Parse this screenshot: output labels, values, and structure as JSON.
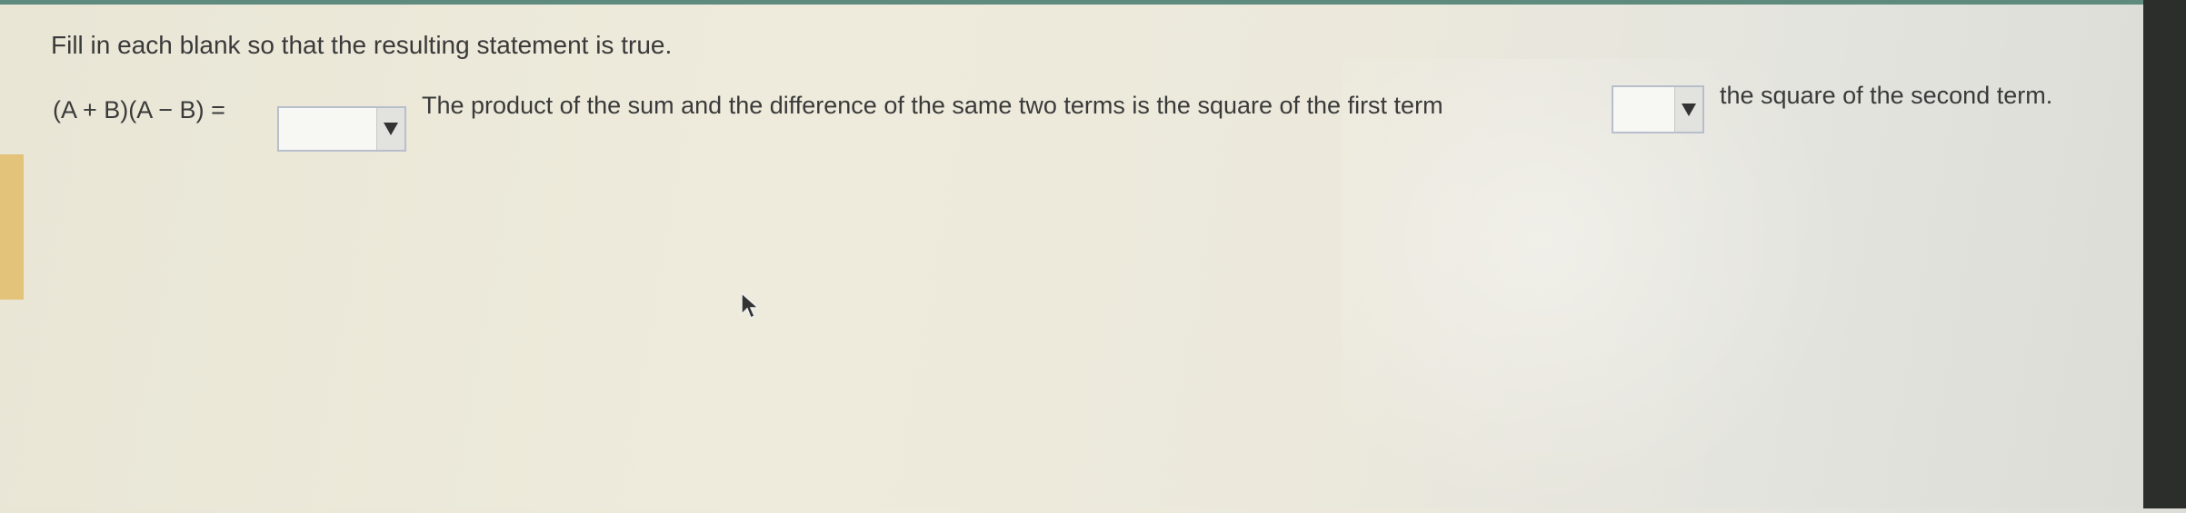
{
  "question": {
    "instructions": "Fill in each blank so that the resulting statement is true.",
    "expression": "(A + B)(A − B) =",
    "statement_part1": "The product of the sum and the difference of the same two terms is the square of the first term",
    "statement_part2": "the square of the second term.",
    "blank1": {
      "selected_value": "",
      "icon": "dropdown-arrow-icon"
    },
    "blank2": {
      "selected_value": "",
      "icon": "dropdown-arrow-icon"
    }
  },
  "colors": {
    "text": "#3a3a3a",
    "dropdown_border": "#b8bfcc",
    "arrow_button": "#e2e2de",
    "top_strip": "#5e8b7e",
    "left_accent": "#e3c37a"
  }
}
